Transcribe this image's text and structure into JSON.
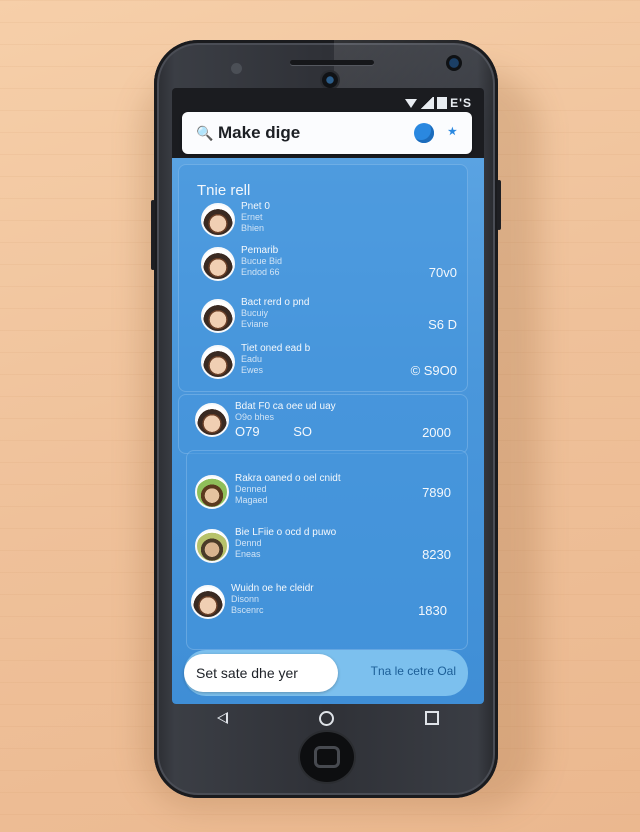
{
  "status": {
    "time": "E'S"
  },
  "search": {
    "title": "Make dige"
  },
  "list": {
    "title": "Tnie rell",
    "items": [
      {
        "name": "Pnet 0",
        "line2": "Ernet",
        "line3": "Bhien",
        "amount": ""
      },
      {
        "name": "Pemarib",
        "line2": "Bucue Bid",
        "line3": "Endod 66",
        "amount": "70v0"
      },
      {
        "name": "Bact rerd o pnd",
        "line2": "Bucuiy",
        "line3": "Eviane",
        "amount": "S6 D"
      },
      {
        "name": "Tiet oned ead b",
        "line2": "Eadu",
        "line3": "Ewes",
        "amount": "© S9O0"
      }
    ]
  },
  "highlight": {
    "name": "Bdat F0 ca oee ud uay",
    "line2": "O9o  bhes",
    "value": "O79",
    "mid": "SO",
    "amount": "2000"
  },
  "list2": {
    "items": [
      {
        "name": "Rakra oaned o oel cnidt",
        "line2": "Denned",
        "line3": "Magaed",
        "amount": "7890"
      },
      {
        "name": "Bie LFiie o ocd d puwo",
        "line2": "Dennd",
        "line3": "Eneas",
        "amount": "8230"
      },
      {
        "name": "Wuidn oe he cleidr",
        "line2": "Disonn",
        "line3": "Bscenrc",
        "amount": "1830"
      }
    ]
  },
  "bottom": {
    "primary": "Set sate dhe yer",
    "secondary": "Tna le cetre Oal"
  },
  "colors": {
    "accent": "#2a88e0",
    "content_bg": "#4a97db"
  }
}
